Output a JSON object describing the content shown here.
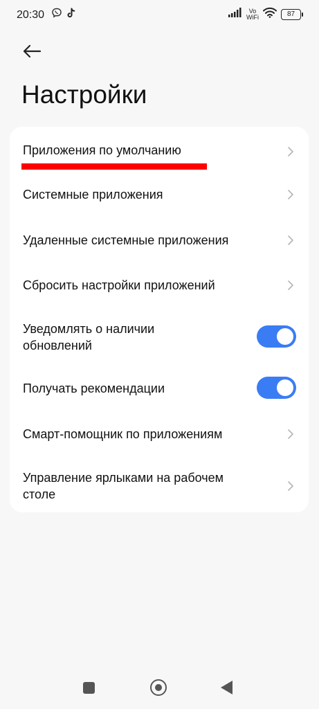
{
  "status_bar": {
    "time": "20:30",
    "volte_top": "Vo",
    "volte_bottom": "WiFi",
    "battery": "87"
  },
  "header": {
    "title": "Настройки"
  },
  "settings": {
    "items": [
      {
        "label": "Приложения по умолчанию",
        "control": "chevron"
      },
      {
        "label": "Системные приложения",
        "control": "chevron"
      },
      {
        "label": "Удаленные системные приложения",
        "control": "chevron"
      },
      {
        "label": "Сбросить настройки приложений",
        "control": "chevron"
      },
      {
        "label": "Уведомлять о наличии обновлений",
        "control": "toggle",
        "on": true
      },
      {
        "label": "Получать рекомендации",
        "control": "toggle",
        "on": true
      },
      {
        "label": "Смарт-помощник по приложениям",
        "control": "chevron"
      },
      {
        "label": "Управление ярлыками на рабочем столе",
        "control": "chevron"
      }
    ]
  },
  "colors": {
    "toggle_on": "#3a7cf4",
    "highlight": "#ff0000",
    "background": "#f7f7f7",
    "card": "#ffffff"
  },
  "icons": {
    "status_left": [
      "viber-icon",
      "tiktok-icon"
    ],
    "status_right": [
      "signal-icon",
      "volte-icon",
      "wifi-icon",
      "battery-icon"
    ],
    "navigation": [
      "recents-icon",
      "home-icon",
      "back-triangle-icon"
    ]
  }
}
